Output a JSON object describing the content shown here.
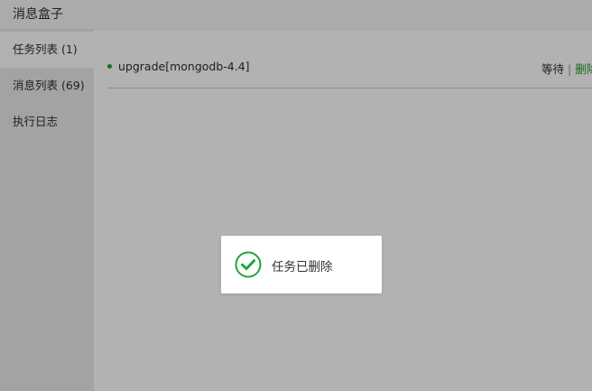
{
  "header": {
    "title": "消息盒子"
  },
  "sidebar": {
    "items": [
      {
        "label": "任务列表 (1)",
        "active": true
      },
      {
        "label": "消息列表 (69)",
        "active": false
      },
      {
        "label": "执行日志",
        "active": false
      }
    ]
  },
  "tasks": [
    {
      "name": "upgrade[mongodb-4.4]",
      "status": "等待",
      "separator": "|",
      "delete_label": "删除"
    }
  ],
  "toast": {
    "message": "任务已删除",
    "icon": "check-circle-icon"
  },
  "colors": {
    "accent": "#20a53a",
    "link_green": "#1b6b18",
    "overlay": "#b2b2b2"
  }
}
